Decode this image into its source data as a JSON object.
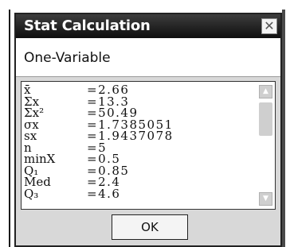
{
  "dialog": {
    "title": "Stat Calculation",
    "close_glyph": "✕",
    "subtitle": "One-Variable",
    "ok_label": "OK"
  },
  "stats": [
    {
      "label": "x̄",
      "value": "=2.66"
    },
    {
      "label": "Σx",
      "value": "=13.3"
    },
    {
      "label": "Σx²",
      "value": "=50.49"
    },
    {
      "label": "σx",
      "value": "=1.7385051"
    },
    {
      "label": "sx",
      "value": "=1.9437078"
    },
    {
      "label": "n",
      "value": "=5"
    },
    {
      "label": "minX",
      "value": "=0.5"
    },
    {
      "label": "Q₁",
      "value": "=0.85"
    },
    {
      "label": "Med",
      "value": "=2.4"
    },
    {
      "label": "Q₃",
      "value": "=4.6"
    }
  ],
  "scroll": {
    "up_icon": "triangle-up-icon",
    "down_icon": "triangle-down-icon"
  },
  "colors": {
    "titlebar": "#1a1a1a",
    "dialog_bg": "#d8d8d8",
    "scroll_grey": "#cfcfcf"
  }
}
